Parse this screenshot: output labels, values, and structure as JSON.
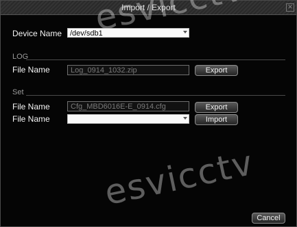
{
  "dialog": {
    "title": "Import / Export",
    "close_icon": "✕"
  },
  "device": {
    "label": "Device Name",
    "value": "/dev/sdb1"
  },
  "log": {
    "section_label": "LOG",
    "file_label": "File Name",
    "file_value": "Log_0914_1032.zip",
    "export_label": "Export"
  },
  "set": {
    "section_label": "Set",
    "export_file_label": "File Name",
    "export_file_value": "Cfg_MBD6016E-E_0914.cfg",
    "export_label": "Export",
    "import_file_label": "File Name",
    "import_file_value": "",
    "import_label": "Import"
  },
  "footer": {
    "cancel_label": "Cancel"
  },
  "watermark": {
    "text": "esvicctv"
  },
  "colors": {
    "background": "#050505",
    "title_bar": "#343434",
    "border": "#4a4a4a",
    "text": "#f2f2f2",
    "muted_text": "#9a9a9a"
  }
}
